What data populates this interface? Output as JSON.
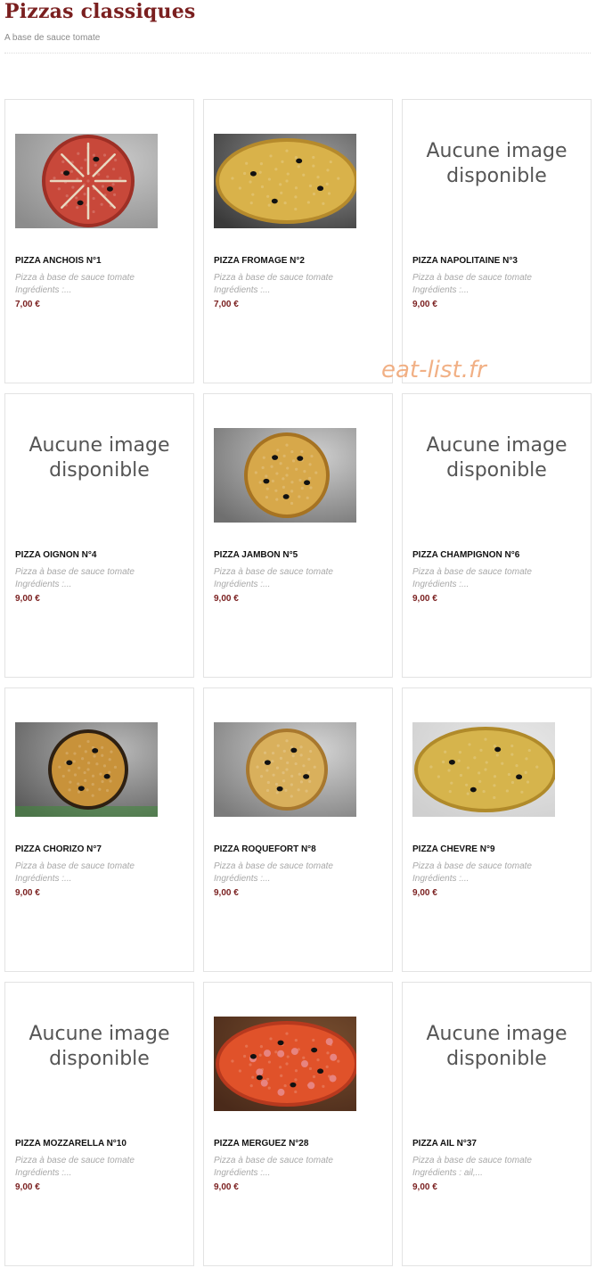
{
  "page": {
    "title": "Pizzas classiques",
    "subtitle": "A base de sauce tomate",
    "watermark": "eat-list.fr"
  },
  "colors": {
    "title": "#7a1f1f",
    "price": "#7a1f1f",
    "watermark": "#f0a878"
  },
  "no_image_text": "Aucune image disponible",
  "items": [
    {
      "name": "PIZZA ANCHOIS N°1",
      "desc1": "Pizza à base de sauce tomate",
      "desc2": "Ingrédients :...",
      "price": "7,00 €",
      "image": "pizza-anchois"
    },
    {
      "name": "PIZZA FROMAGE N°2",
      "desc1": "Pizza à base de sauce tomate",
      "desc2": "Ingrédients :...",
      "price": "7,00 €",
      "image": "pizza-fromage"
    },
    {
      "name": "PIZZA NAPOLITAINE N°3",
      "desc1": "Pizza à base de sauce tomate",
      "desc2": "Ingrédients :...",
      "price": "9,00 €",
      "image": null
    },
    {
      "name": "PIZZA OIGNON N°4",
      "desc1": "Pizza à base de sauce tomate",
      "desc2": "Ingrédients :...",
      "price": "9,00 €",
      "image": null
    },
    {
      "name": "PIZZA JAMBON N°5",
      "desc1": "Pizza à base de sauce tomate",
      "desc2": "Ingrédients :...",
      "price": "9,00 €",
      "image": "pizza-jambon"
    },
    {
      "name": "PIZZA CHAMPIGNON N°6",
      "desc1": "Pizza à base de sauce tomate",
      "desc2": "Ingrédients :...",
      "price": "9,00 €",
      "image": null
    },
    {
      "name": "PIZZA CHORIZO N°7",
      "desc1": "Pizza à base de sauce tomate",
      "desc2": "Ingrédients :...",
      "price": "9,00 €",
      "image": "pizza-chorizo"
    },
    {
      "name": "PIZZA ROQUEFORT N°8",
      "desc1": "Pizza à base de sauce tomate",
      "desc2": "Ingrédients :...",
      "price": "9,00 €",
      "image": "pizza-roquefort"
    },
    {
      "name": "PIZZA CHEVRE N°9",
      "desc1": "Pizza à base de sauce tomate",
      "desc2": "Ingrédients :...",
      "price": "9,00 €",
      "image": "pizza-chevre"
    },
    {
      "name": "PIZZA MOZZARELLA N°10",
      "desc1": "Pizza à base de sauce tomate",
      "desc2": "Ingrédients :...",
      "price": "9,00 €",
      "image": null
    },
    {
      "name": "PIZZA MERGUEZ N°28",
      "desc1": "Pizza à base de sauce tomate",
      "desc2": "Ingrédients :...",
      "price": "9,00 €",
      "image": "pizza-merguez"
    },
    {
      "name": "PIZZA AIL N°37",
      "desc1": "Pizza à base de sauce tomate",
      "desc2": "Ingrédients : ail,...",
      "price": "9,00 €",
      "image": null
    }
  ]
}
